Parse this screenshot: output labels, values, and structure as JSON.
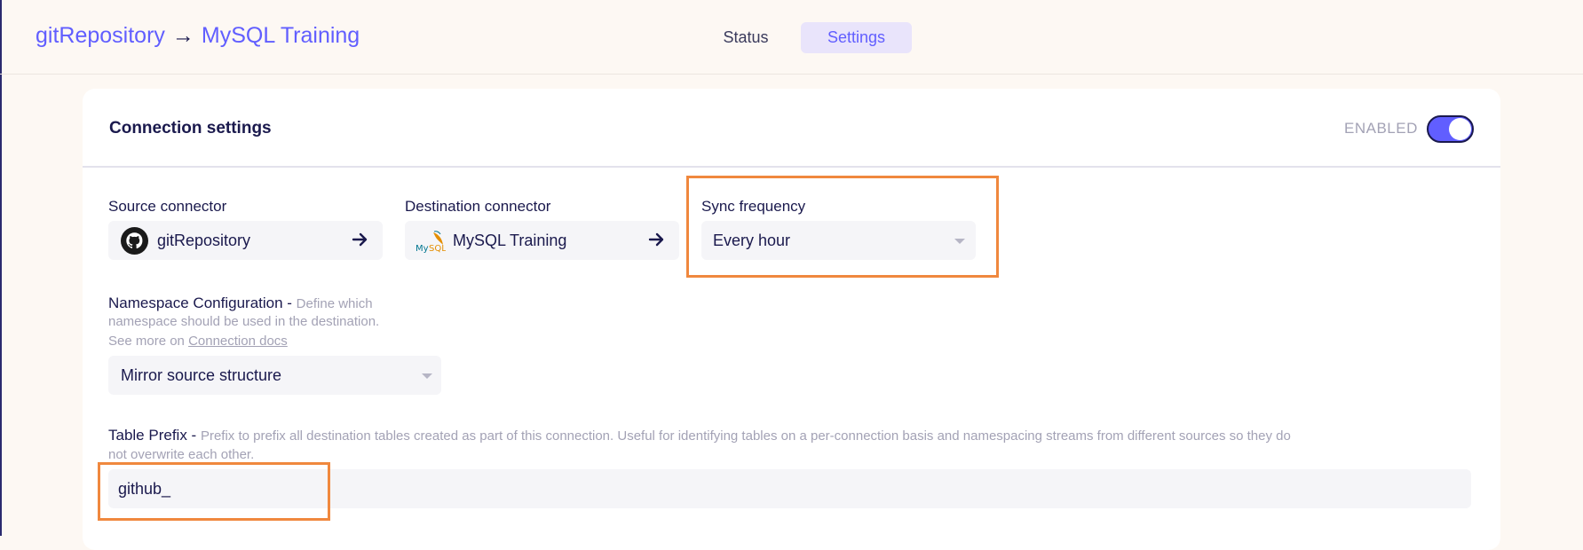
{
  "header": {
    "breadcrumb_source": "gitRepository",
    "breadcrumb_separator": "→",
    "breadcrumb_destination": "MySQL Training",
    "tabs": [
      {
        "label": "Status",
        "active": false
      },
      {
        "label": "Settings",
        "active": true
      }
    ]
  },
  "card": {
    "title": "Connection settings",
    "enabled_label": "ENABLED",
    "enabled": true
  },
  "source": {
    "label": "Source connector",
    "value": "gitRepository",
    "icon": "github-icon"
  },
  "destination": {
    "label": "Destination connector",
    "value": "MySQL Training",
    "icon": "mysql-icon"
  },
  "sync": {
    "label": "Sync frequency",
    "value": "Every hour"
  },
  "namespace": {
    "label": "Namespace Configuration - ",
    "hint_line1": "Define which",
    "hint_line2": "namespace should be used in the destination.",
    "hint_line3_prefix": "See more on ",
    "docs_link": "Connection docs",
    "value": "Mirror source structure"
  },
  "table_prefix": {
    "label": "Table Prefix - ",
    "hint_line1": "Prefix to prefix all destination tables created as part of this connection. Useful for identifying tables on a per-connection basis and namespacing streams from different sources so they do",
    "hint_line2": "not overwrite each other.",
    "value": "github_"
  },
  "colors": {
    "accent": "#615eff",
    "highlight": "#f0883e",
    "text": "#1a194d",
    "muted": "#a3a2b5",
    "background": "#fdf8f3"
  }
}
